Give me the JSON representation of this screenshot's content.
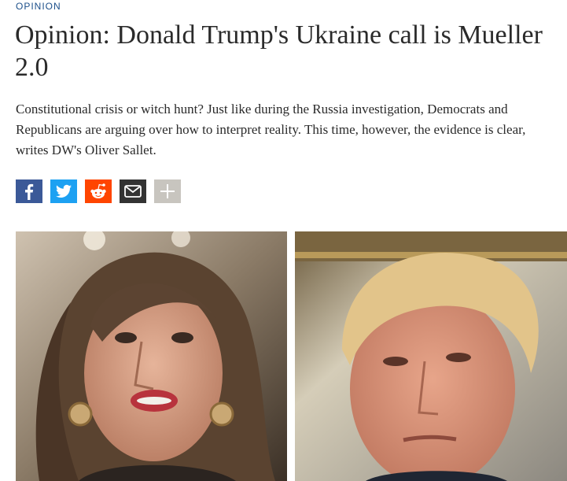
{
  "article": {
    "kicker": "OPINION",
    "headline": "Opinion: Donald Trump's Ukraine call is Mueller 2.0",
    "teaser": "Constitutional crisis or witch hunt? Just like during the Russia investigation, Democrats and Republicans are arguing over how to interpret reality. This time, however, the evidence is clear, writes DW's Oliver Sallet."
  },
  "share": {
    "buttons": [
      {
        "name": "facebook",
        "icon": "facebook-icon",
        "color": "#3b5998"
      },
      {
        "name": "twitter",
        "icon": "twitter-icon",
        "color": "#1da1f2"
      },
      {
        "name": "reddit",
        "icon": "reddit-icon",
        "color": "#ff4500"
      },
      {
        "name": "email",
        "icon": "envelope-icon",
        "color": "#333333"
      },
      {
        "name": "more",
        "icon": "plus-icon",
        "color": "#c8c5bf"
      }
    ]
  },
  "images": [
    {
      "name": "photo-pelosi"
    },
    {
      "name": "photo-trump"
    }
  ]
}
